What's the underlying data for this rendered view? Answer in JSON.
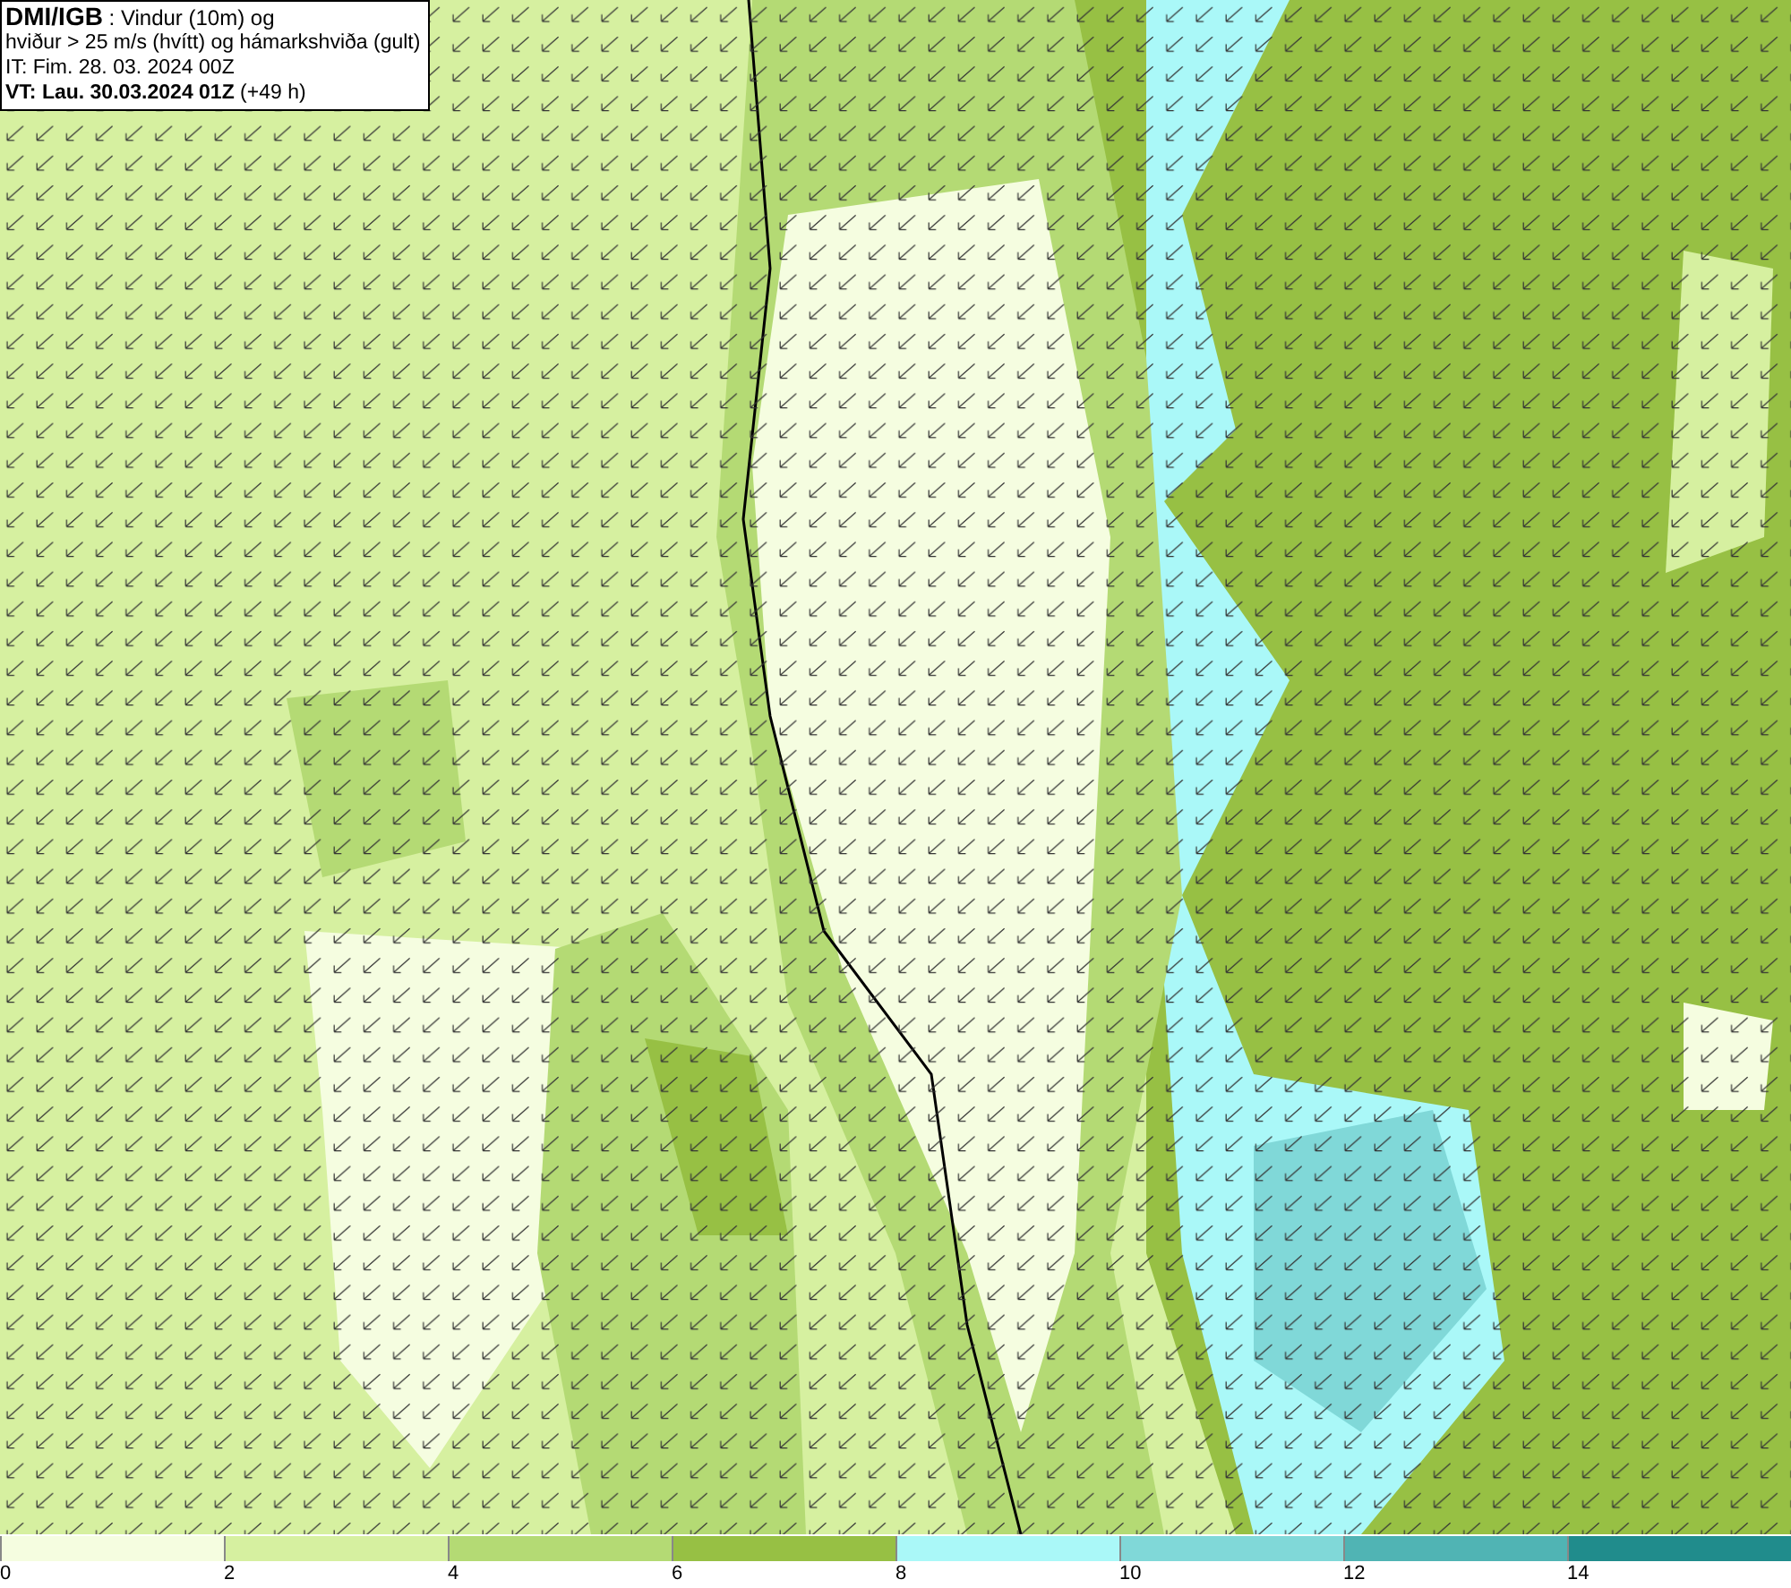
{
  "title_box": {
    "lines": [
      "**DMI/IGB** : Vindur (10m) og",
      "hviður > 25 m/s (hvítt) og hámarkshviða (gult)",
      "IT: Fim. 28. 03. 2024 00Z",
      "**VT: Lau. 30.03.2024 01Z** (+49 h)"
    ]
  },
  "legend": {
    "items": [
      {
        "label": "0",
        "color": "#f5fde0"
      },
      {
        "label": "2",
        "color": "#d6f0a0"
      },
      {
        "label": "4",
        "color": "#b4da74"
      },
      {
        "label": "6",
        "color": "#97c044"
      },
      {
        "label": "8",
        "color": "#aaf8f8"
      },
      {
        "label": "10",
        "color": "#80d8d8"
      },
      {
        "label": "12",
        "color": "#50b4b4"
      },
      {
        "label": "14",
        "color": "#208c8c"
      }
    ]
  }
}
